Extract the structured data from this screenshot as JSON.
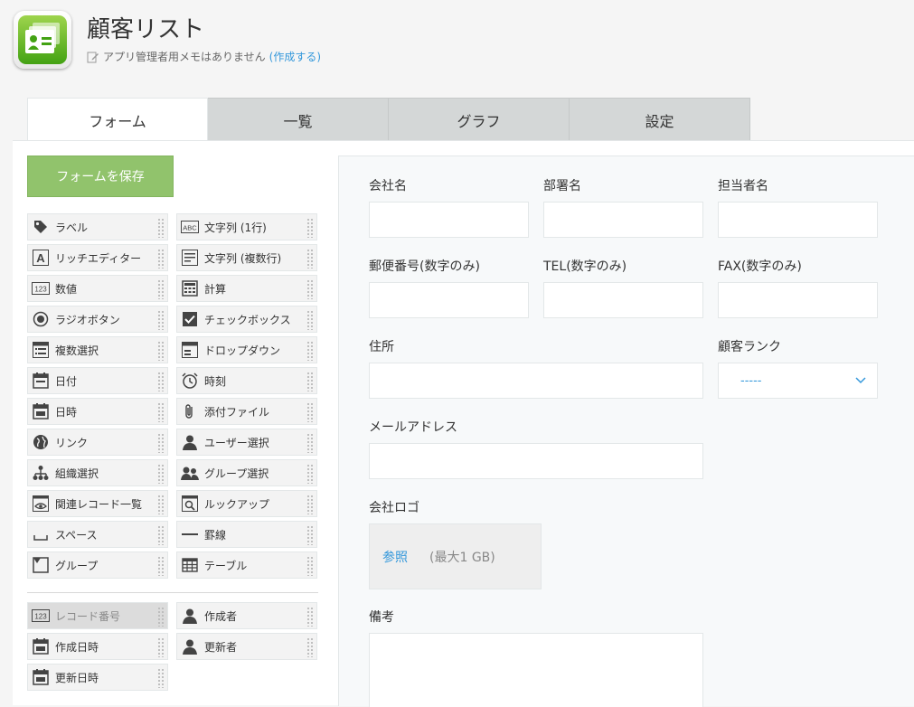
{
  "app": {
    "title": "顧客リスト",
    "memo_text": "アプリ管理者用メモはありません",
    "memo_link": "(作成する)"
  },
  "tabs": [
    {
      "label": "フォーム",
      "active": true
    },
    {
      "label": "一覧",
      "active": false
    },
    {
      "label": "グラフ",
      "active": false
    },
    {
      "label": "設定",
      "active": false
    }
  ],
  "palette": {
    "save_label": "フォームを保存",
    "parts": [
      {
        "label": "ラベル",
        "icon": "tag-icon"
      },
      {
        "label": "文字列 (1行)",
        "icon": "abc-icon"
      },
      {
        "label": "リッチエディター",
        "icon": "rich-editor-icon"
      },
      {
        "label": "文字列 (複数行)",
        "icon": "multiline-text-icon"
      },
      {
        "label": "数値",
        "icon": "number-icon"
      },
      {
        "label": "計算",
        "icon": "calculator-icon"
      },
      {
        "label": "ラジオボタン",
        "icon": "radio-icon"
      },
      {
        "label": "チェックボックス",
        "icon": "checkbox-icon"
      },
      {
        "label": "複数選択",
        "icon": "multi-select-icon"
      },
      {
        "label": "ドロップダウン",
        "icon": "dropdown-icon"
      },
      {
        "label": "日付",
        "icon": "calendar-icon"
      },
      {
        "label": "時刻",
        "icon": "clock-icon"
      },
      {
        "label": "日時",
        "icon": "calendar-icon"
      },
      {
        "label": "添付ファイル",
        "icon": "paperclip-icon"
      },
      {
        "label": "リンク",
        "icon": "globe-icon"
      },
      {
        "label": "ユーザー選択",
        "icon": "user-icon"
      },
      {
        "label": "組織選択",
        "icon": "org-chart-icon"
      },
      {
        "label": "グループ選択",
        "icon": "group-icon"
      },
      {
        "label": "関連レコード一覧",
        "icon": "related-records-icon"
      },
      {
        "label": "ルックアップ",
        "icon": "lookup-icon"
      },
      {
        "label": "スペース",
        "icon": "space-icon"
      },
      {
        "label": "罫線",
        "icon": "line-icon"
      },
      {
        "label": "グループ",
        "icon": "group-folder-icon"
      },
      {
        "label": "テーブル",
        "icon": "table-icon"
      }
    ],
    "system_parts": [
      {
        "label": "レコード番号",
        "icon": "number-icon",
        "disabled": true
      },
      {
        "label": "作成者",
        "icon": "user-icon",
        "disabled": false
      },
      {
        "label": "作成日時",
        "icon": "calendar-icon",
        "disabled": false
      },
      {
        "label": "更新者",
        "icon": "user-icon",
        "disabled": false
      },
      {
        "label": "更新日時",
        "icon": "calendar-icon",
        "disabled": false
      }
    ]
  },
  "form": {
    "company_name": "会社名",
    "department": "部署名",
    "contact_person": "担当者名",
    "postal_code": "郵便番号(数字のみ)",
    "tel": "TEL(数字のみ)",
    "fax": "FAX(数字のみ)",
    "address": "住所",
    "customer_rank": "顧客ランク",
    "customer_rank_value": "-----",
    "email": "メールアドレス",
    "company_logo": "会社ロゴ",
    "browse_label": "参照",
    "max_size_note": "(最大1 GB)",
    "remarks": "備考"
  },
  "colors": {
    "accent": "#3498db",
    "save_button": "#91c36c"
  }
}
